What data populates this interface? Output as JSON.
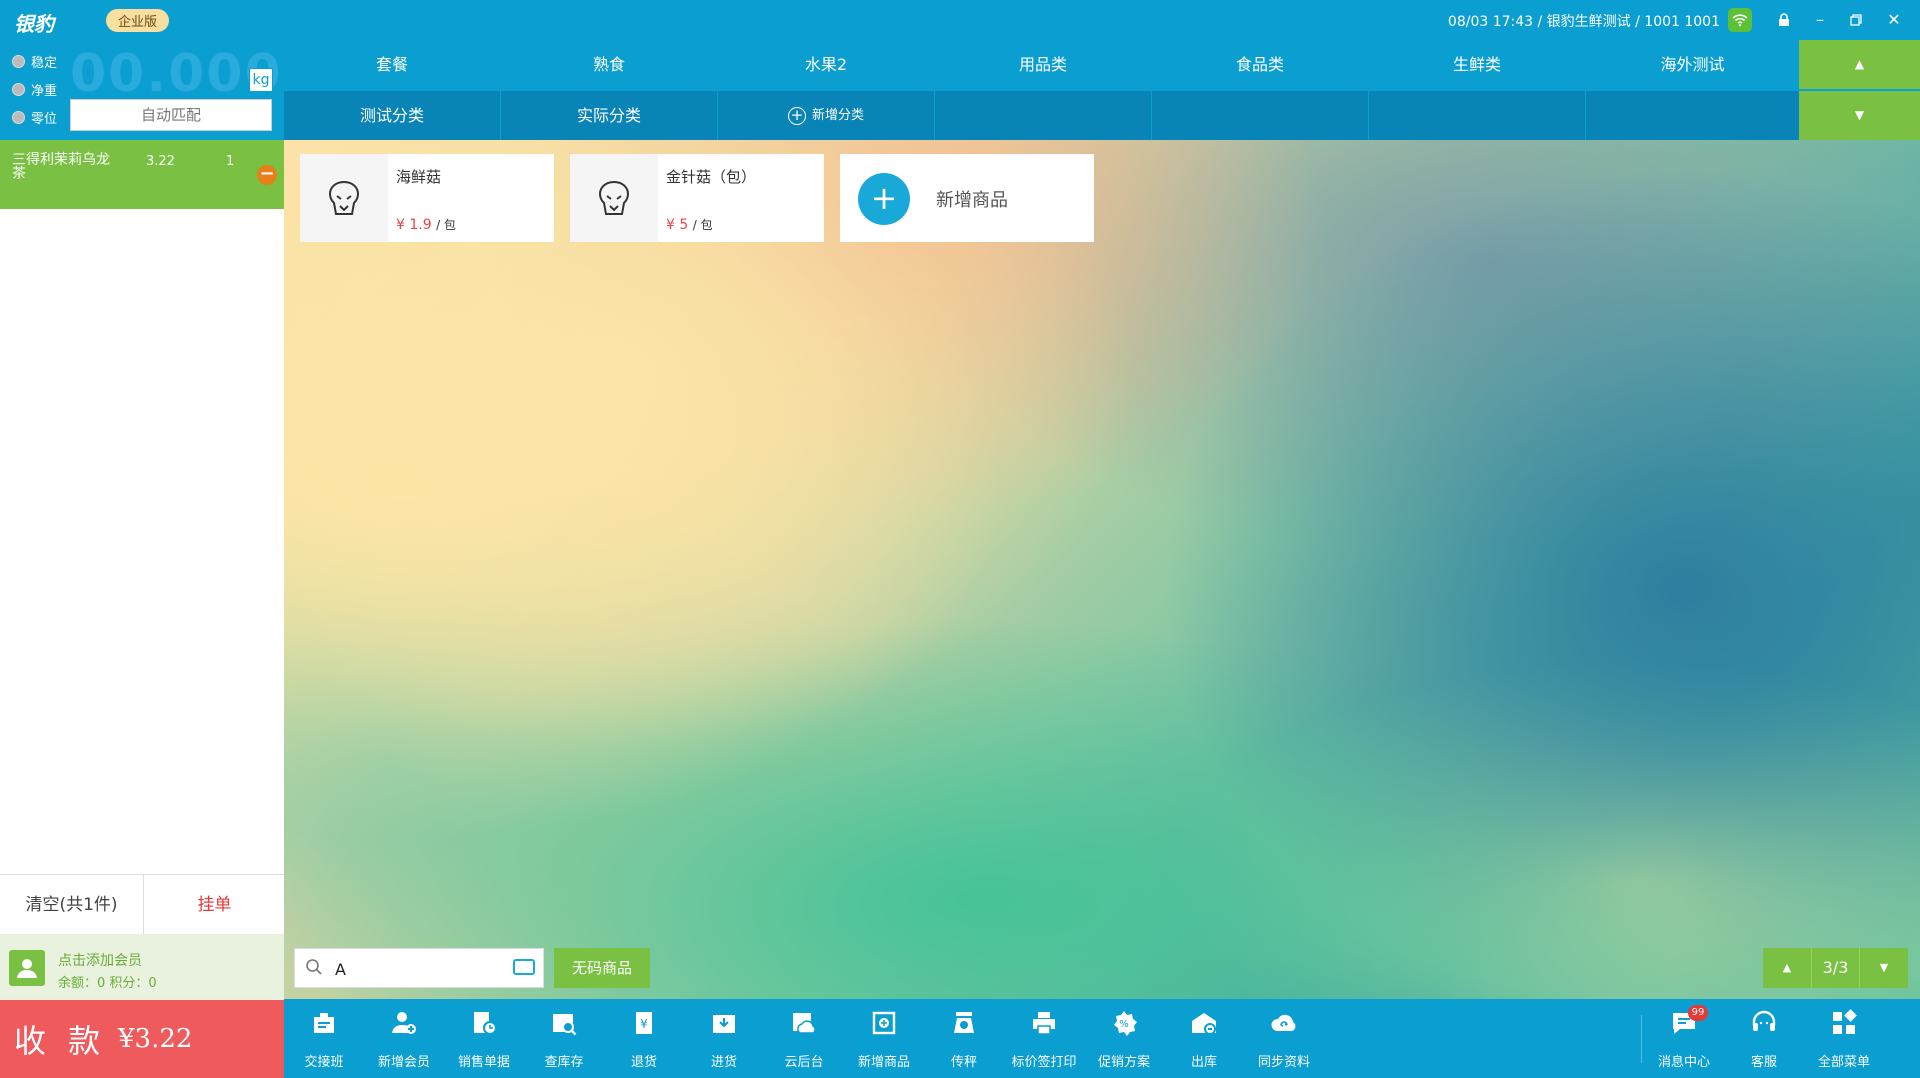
{
  "titlebar": {
    "logo": "银豹",
    "edition": "企业版",
    "info": "08/03 17:43 / 银豹生鲜测试 / 1001 1001"
  },
  "scale": {
    "indicators": [
      "稳定",
      "净重",
      "零位"
    ],
    "weight": "00.000",
    "unit": "kg",
    "auto_match": "自动匹配"
  },
  "cart": {
    "items": [
      {
        "name": "三得利茉莉乌龙茶",
        "price": "3.22",
        "qty": "1"
      }
    ]
  },
  "actions": {
    "clear": "清空(共1件)",
    "hold": "挂单"
  },
  "member": {
    "add": "点击添加会员",
    "balance": "余额：0  积分：0"
  },
  "payment": {
    "label": "收 款",
    "amount": "¥3.22"
  },
  "categories": {
    "row1": [
      "套餐",
      "熟食",
      "水果2",
      "用品类",
      "食品类",
      "生鲜类",
      "海外测试"
    ],
    "row2": [
      "测试分类",
      "实际分类"
    ],
    "add": "新增分类"
  },
  "products": [
    {
      "name": "海鲜菇",
      "price": "¥ 1.9",
      "unit": "/ 包"
    },
    {
      "name": "金针菇（包）",
      "price": "¥ 5",
      "unit": "/ 包"
    }
  ],
  "add_product": "新增商品",
  "search": {
    "value": "A"
  },
  "no_code": "无码商品",
  "pager": {
    "page": "3/3"
  },
  "toolbar": {
    "items": [
      "交接班",
      "新增会员",
      "销售单据",
      "查库存",
      "退货",
      "进货",
      "云后台",
      "新增商品",
      "传秤",
      "标价签打印",
      "促销方案",
      "出库",
      "同步资料"
    ],
    "right": [
      "消息中心",
      "客服",
      "全部菜单"
    ],
    "badge": "99"
  },
  "colors": {
    "primary": "#0a9ed1",
    "green": "#7ac143",
    "pay": "#ef5a5c",
    "price": "#e94545"
  }
}
